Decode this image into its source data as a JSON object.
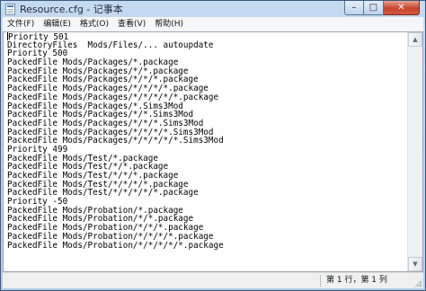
{
  "window": {
    "title": "Resource.cfg - 记事本",
    "min_symbol": "–",
    "max_symbol": "□",
    "close_symbol": "✕"
  },
  "menu": [
    "文件(F)",
    "编辑(E)",
    "格式(O)",
    "查看(V)",
    "帮助(H)"
  ],
  "content": {
    "lines": [
      "Priority 501",
      "DirectoryFiles  Mods/Files/... autoupdate",
      "Priority 500",
      "PackedFile Mods/Packages/*.package",
      "PackedFile Mods/Packages/*/*.package",
      "PackedFile Mods/Packages/*/*/*.package",
      "PackedFile Mods/Packages/*/*/*/*.package",
      "PackedFile Mods/Packages/*/*/*/*/*.package",
      "PackedFile Mods/Packages/*.Sims3Mod",
      "PackedFile Mods/Packages/*/*.Sims3Mod",
      "PackedFile Mods/Packages/*/*/*.Sims3Mod",
      "PackedFile Mods/Packages/*/*/*/*.Sims3Mod",
      "PackedFile Mods/Packages/*/*/*/*/*.Sims3Mod",
      "Priority 499",
      "PackedFile Mods/Test/*.package",
      "PackedFile Mods/Test/*/*.package",
      "PackedFile Mods/Test/*/*/*.package",
      "PackedFile Mods/Test/*/*/*/*.package",
      "PackedFile Mods/Test/*/*/*/*/*.package",
      "Priority -50",
      "PackedFile Mods/Probation/*.package",
      "PackedFile Mods/Probation/*/*.package",
      "PackedFile Mods/Probation/*/*/*.package",
      "PackedFile Mods/Probation/*/*/*/*.package",
      "PackedFile Mods/Probation/*/*/*/*/*.package"
    ]
  },
  "scrollbar": {
    "up_symbol": "▲",
    "down_symbol": "▼"
  },
  "status": {
    "position": "第 1 行，第 1 列"
  }
}
